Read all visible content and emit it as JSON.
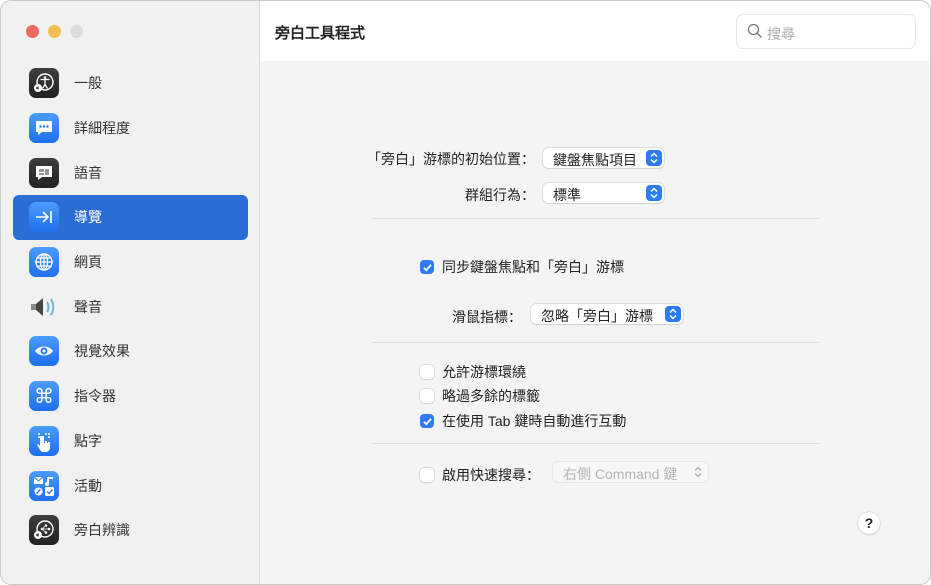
{
  "window": {
    "title": "旁白工具程式",
    "search_placeholder": "搜尋"
  },
  "sidebar": {
    "items": [
      {
        "label": "一般",
        "icon": "accessibility-voiceover-icon"
      },
      {
        "label": "詳細程度",
        "icon": "speech-bubble-dots-icon"
      },
      {
        "label": "語音",
        "icon": "speech-bubble-icon"
      },
      {
        "label": "導覽",
        "icon": "arrow-to-bar-icon",
        "selected": true
      },
      {
        "label": "網頁",
        "icon": "globe-icon"
      },
      {
        "label": "聲音",
        "icon": "speaker-icon"
      },
      {
        "label": "視覺效果",
        "icon": "eye-icon"
      },
      {
        "label": "指令器",
        "icon": "command-key-icon"
      },
      {
        "label": "點字",
        "icon": "braille-hand-icon"
      },
      {
        "label": "活動",
        "icon": "activities-icon"
      },
      {
        "label": "旁白辨識",
        "icon": "voiceover-recognition-icon"
      }
    ]
  },
  "settings": {
    "initial_position_label": "「旁白」游標的初始位置：",
    "initial_position_value": "鍵盤焦點項目",
    "group_behavior_label": "群組行為：",
    "group_behavior_value": "標準",
    "sync_focus_label": "同步鍵盤焦點和「旁白」游標",
    "sync_focus_checked": true,
    "mouse_pointer_label": "滑鼠指標：",
    "mouse_pointer_value": "忽略「旁白」游標",
    "allow_wrap_label": "允許游標環繞",
    "allow_wrap_checked": false,
    "skip_redundant_label": "略過多餘的標籤",
    "skip_redundant_checked": false,
    "auto_interact_label": "在使用 Tab 鍵時自動進行互動",
    "auto_interact_checked": true,
    "quick_search_label": "啟用快速搜尋：",
    "quick_search_checked": false,
    "quick_search_value": "右側 Command 鍵"
  },
  "help_label": "?",
  "colors": {
    "accent": "#2a6dd5",
    "checkbox_on": "#2d7cf6"
  }
}
